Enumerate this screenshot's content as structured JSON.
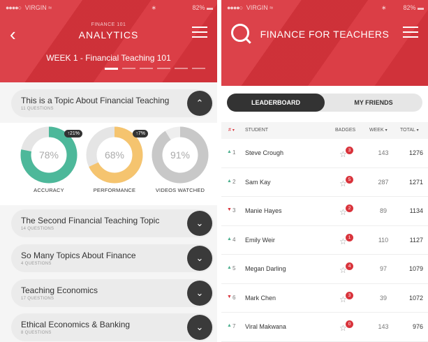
{
  "left": {
    "status": {
      "signal": "●●●●○",
      "carrier": "VIRGIN",
      "wifi": "≈",
      "bt": "∗",
      "battery": "82%",
      "battery_icon": "▬"
    },
    "header": {
      "subtitle": "FINANCE 101",
      "title": "ANALYTICS",
      "week_label": "WEEK 1 - Financial Teaching 101",
      "back_icon": "‹",
      "pager_count": 6,
      "pager_active": 0
    },
    "expanded_topic": {
      "title": "This is a Topic About Financial Teaching",
      "questions": "11 QUESTIONS",
      "toggle_icon": "⌃"
    },
    "stats": [
      {
        "label": "ACCURACY",
        "value": "78%",
        "percent": 78,
        "color": "#4db89a",
        "badge": "↑21%"
      },
      {
        "label": "PERFORMANCE",
        "value": "68%",
        "percent": 68,
        "color": "#f5c46f",
        "badge": "↑7%"
      },
      {
        "label": "VIDEOS WATCHED",
        "value": "91%",
        "percent": 91,
        "color": "#c8c8c8",
        "badge": ""
      }
    ],
    "topics": [
      {
        "title": "The Second Financial Teaching Topic",
        "questions": "14 QUESTIONS",
        "toggle_icon": "⌄"
      },
      {
        "title": "So Many Topics About Finance",
        "questions": "4 QUESTIONS",
        "toggle_icon": "⌄"
      },
      {
        "title": "Teaching Economics",
        "questions": "17 QUESTIONS",
        "toggle_icon": "⌄"
      },
      {
        "title": "Ethical Economics & Banking",
        "questions": "8 QUESTIONS",
        "toggle_icon": "⌄"
      }
    ]
  },
  "right": {
    "status": {
      "signal": "●●●●○",
      "carrier": "VIRGIN",
      "wifi": "≈",
      "bt": "∗",
      "battery": "82%",
      "battery_icon": "▬"
    },
    "header": {
      "title": "FINANCE FOR TEACHERS"
    },
    "tabs": {
      "leaderboard": "LEADERBOARD",
      "friends": "MY FRIENDS"
    },
    "columns": {
      "rank": "#",
      "student": "STUDENT",
      "badges": "BADGES",
      "week": "WEEK",
      "total": "TOTAL",
      "sort_icon": "▾"
    },
    "rows": [
      {
        "trend": "up",
        "trend_icon": "▲",
        "rank": "1",
        "student": "Steve Crough",
        "badges": "3",
        "week": "143",
        "total": "1276"
      },
      {
        "trend": "up",
        "trend_icon": "▲",
        "rank": "2",
        "student": "Sam Kay",
        "badges": "5",
        "week": "287",
        "total": "1271"
      },
      {
        "trend": "down",
        "trend_icon": "▼",
        "rank": "3",
        "student": "Manie Hayes",
        "badges": "2",
        "week": "89",
        "total": "1134"
      },
      {
        "trend": "up",
        "trend_icon": "▲",
        "rank": "4",
        "student": "Emily Weir",
        "badges": "1",
        "week": "110",
        "total": "1127"
      },
      {
        "trend": "up",
        "trend_icon": "▲",
        "rank": "5",
        "student": "Megan Darling",
        "badges": "4",
        "week": "97",
        "total": "1079"
      },
      {
        "trend": "down",
        "trend_icon": "▼",
        "rank": "6",
        "student": "Mark Chen",
        "badges": "3",
        "week": "39",
        "total": "1072"
      },
      {
        "trend": "up",
        "trend_icon": "▲",
        "rank": "7",
        "student": "Viral Makwana",
        "badges": "0",
        "week": "143",
        "total": "976"
      }
    ]
  },
  "colors": {
    "brand_red": "#d9343c",
    "dark": "#333333"
  }
}
